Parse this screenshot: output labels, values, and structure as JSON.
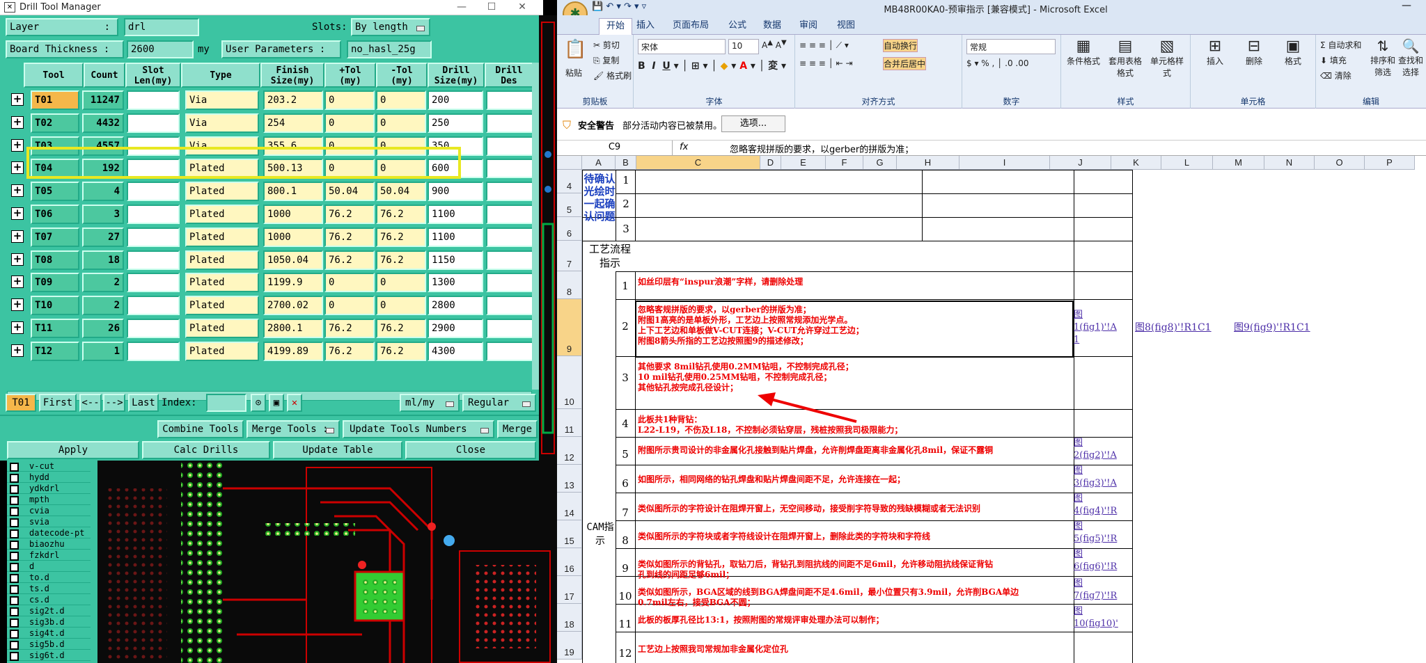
{
  "drill": {
    "title": "Drill Tool Manager",
    "layer_label": "Layer",
    "layer_colon": ":",
    "layer_value": "drl",
    "slots_label": "Slots:",
    "slots_value": "By length",
    "board_label": "Board Thickness :",
    "board_value": "2600",
    "board_unit": "my",
    "user_params_label": "User Parameters :",
    "user_params_value": "no_hasl_25g",
    "headers": [
      "Tool",
      "Count",
      "Slot Len(my)",
      "Type",
      "Finish Size(my)",
      "+Tol (my)",
      "-Tol (my)",
      "Drill Size(my)",
      "Drill Des"
    ],
    "rows": [
      {
        "tool": "T01",
        "count": "11247",
        "type": "Via",
        "finish": "203.2",
        "ptol": "0",
        "mtol": "0",
        "drill": "200"
      },
      {
        "tool": "T02",
        "count": "4432",
        "type": "Via",
        "finish": "254",
        "ptol": "0",
        "mtol": "0",
        "drill": "250"
      },
      {
        "tool": "T03",
        "count": "4557",
        "type": "Via",
        "finish": "355.6",
        "ptol": "0",
        "mtol": "0",
        "drill": "350"
      },
      {
        "tool": "T04",
        "count": "192",
        "type": "Plated",
        "finish": "500.13",
        "ptol": "0",
        "mtol": "0",
        "drill": "600"
      },
      {
        "tool": "T05",
        "count": "4",
        "type": "Plated",
        "finish": "800.1",
        "ptol": "50.04",
        "mtol": "50.04",
        "drill": "900"
      },
      {
        "tool": "T06",
        "count": "3",
        "type": "Plated",
        "finish": "1000",
        "ptol": "76.2",
        "mtol": "76.2",
        "drill": "1100"
      },
      {
        "tool": "T07",
        "count": "27",
        "type": "Plated",
        "finish": "1000",
        "ptol": "76.2",
        "mtol": "76.2",
        "drill": "1100"
      },
      {
        "tool": "T08",
        "count": "18",
        "type": "Plated",
        "finish": "1050.04",
        "ptol": "76.2",
        "mtol": "76.2",
        "drill": "1150"
      },
      {
        "tool": "T09",
        "count": "2",
        "type": "Plated",
        "finish": "1199.9",
        "ptol": "0",
        "mtol": "0",
        "drill": "1300"
      },
      {
        "tool": "T10",
        "count": "2",
        "type": "Plated",
        "finish": "2700.02",
        "ptol": "0",
        "mtol": "0",
        "drill": "2800"
      },
      {
        "tool": "T11",
        "count": "26",
        "type": "Plated",
        "finish": "2800.1",
        "ptol": "76.2",
        "mtol": "76.2",
        "drill": "2900"
      },
      {
        "tool": "T12",
        "count": "1",
        "type": "Plated",
        "finish": "4199.89",
        "ptol": "76.2",
        "mtol": "76.2",
        "drill": "4300"
      }
    ],
    "nav": {
      "current": "T01",
      "first": "First",
      "prev": "<--",
      "next": "-->",
      "last": "Last",
      "index": "Index:",
      "unit": "ml/my",
      "mode": "Regular"
    },
    "combine": "Combine Tools",
    "merge_tools": "Merge Tools :",
    "update_numbers": "Update Tools Numbers",
    "merge": "Merge",
    "apply": "Apply",
    "calc": "Calc Drills",
    "update_table": "Update Table",
    "close": "Close",
    "layers": [
      "v-cut",
      "hydd",
      "ydkdrl",
      "mpth",
      "cvia",
      "svia",
      "datecode-pt",
      "biaozhu",
      "fzkdrl",
      "d",
      "to.d",
      "ts.d",
      "cs.d",
      "sig2t.d",
      "sig3b.d",
      "sig4t.d",
      "sig5b.d",
      "sig6t.d"
    ]
  },
  "excel": {
    "title": "MB48R00KA0-预审指示 [兼容模式] - Microsoft Excel",
    "tabs": [
      "开始",
      "插入",
      "页面布局",
      "公式",
      "数据",
      "审阅",
      "视图"
    ],
    "ribbon": {
      "paste": "粘贴",
      "cut": "剪切",
      "copy": "复制",
      "format_painter": "格式刷",
      "clipboard": "剪贴板",
      "font_name": "宋体",
      "font_size": "10",
      "font": "字体",
      "wrap": "自动换行",
      "merge": "合并后居中",
      "align": "对齐方式",
      "number_format": "常规",
      "number": "数字",
      "cond": "条件格式",
      "table": "套用表格格式",
      "cell_style": "单元格样式",
      "styles": "样式",
      "insert": "插入",
      "delete": "删除",
      "format": "格式",
      "cells": "单元格",
      "autosum": "自动求和",
      "fill": "填充",
      "clear": "清除",
      "sort": "排序和筛选",
      "find": "查找和选择",
      "editing": "编辑"
    },
    "security": {
      "label": "安全警告",
      "msg": "部分活动内容已被禁用。",
      "options": "选项..."
    },
    "namebox": "C9",
    "fx": "fx",
    "formula": "忽略客规拼版的要求，以gerber的拼版为准；",
    "cols": [
      "A",
      "B",
      "C",
      "D",
      "E",
      "F",
      "G",
      "H",
      "I",
      "J",
      "K",
      "L",
      "M",
      "N",
      "O",
      "P"
    ],
    "rows": [
      "4",
      "5",
      "6",
      "7",
      "8",
      "9",
      "10",
      "11",
      "12",
      "13",
      "14",
      "15",
      "16",
      "17",
      "18",
      "19"
    ],
    "confirm_label": "待确认光绘时一起确认问题",
    "confirm_nums": [
      "1",
      "2",
      "3"
    ],
    "process_label": "工艺流程指示",
    "cam_label": "CAM指示",
    "items": [
      {
        "n": "1",
        "text": "如丝印层有“inspur浪潮”字样，请删除处理"
      },
      {
        "n": "2",
        "text": "忽略客规拼版的要求，以gerber的拼版为准；\n附图1高亮的是单板外形，工艺边上按照常规添加光学点。\n上下工艺边和单板做V-CUT连接；V-CUT允许穿过工艺边；\n附图8箭头所指的工艺边按照图9的描述修改；"
      },
      {
        "n": "3",
        "text": "其他要求 8mil钻孔使用0.2MM钻咀，不控制完成孔径；\n10 mil钻孔使用0.25MM钻咀，不控制完成孔径；\n其他钻孔按完成孔径设计；"
      },
      {
        "n": "4",
        "text": "此板共1种背钻：\nL22-L19，不伤及L18，不控制必须钻穿层，残桩按照我司极限能力；"
      },
      {
        "n": "5",
        "text": "附图所示贵司设计的非金属化孔接触到贴片焊盘，允许削焊盘距离非金属化孔8mil，保证不露铜"
      },
      {
        "n": "6",
        "text": "如图所示，相同网络的钻孔焊盘和贴片焊盘间距不足，允许连接在一起；"
      },
      {
        "n": "7",
        "text": "类似图所示的字符设计在阻焊开窗上，无空间移动，接受削字符导致的残缺模糊或者无法识别"
      },
      {
        "n": "8",
        "text": "类似图所示的字符块或者字符线设计在阻焊开窗上，删除此类的字符块和字符线"
      },
      {
        "n": "9",
        "text": "类似如图所示的背钻孔，取钻刀后，背钻孔到阻抗线的间距不足6mil，允许移动阻抗线保证背钻\n孔到线的间距足够6mil；"
      },
      {
        "n": "10",
        "text": "类似如图所示，BGA区域的线到BGA焊盘间距不足4.6mil，最小位置只有3.9mil，允许削BGA单边\n0.7mil左右，接受BGA不圆；"
      },
      {
        "n": "11",
        "text": "此板的板厚孔径比13:1，按照附图的常规评审处理办法可以制作；"
      },
      {
        "n": "12",
        "text": "工艺边上按照我司常规加非金属化定位孔"
      }
    ],
    "links": {
      "r9j": "图\n1(fig1)'!A\n1",
      "r9k": "图8(fig8)'!R1C1",
      "r9m": "图9(fig9)'!R1C1",
      "r12": "图\n2(fig2)'!A",
      "r13": "图\n3(fig3)'!A",
      "r14": "图\n4(fig4)'!R",
      "r15": "图\n5(fig5)'!R",
      "r16": "图\n6(fig6)'!R",
      "r17": "图\n7(fig7)'!R",
      "r18": "图\n10(fig10)'"
    }
  }
}
